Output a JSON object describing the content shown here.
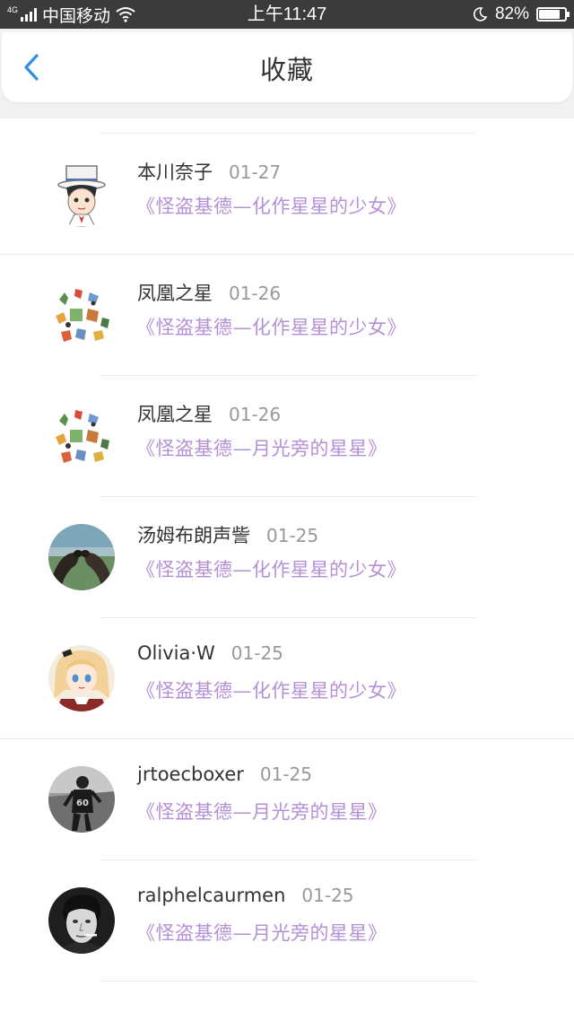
{
  "status_bar": {
    "network": "4G",
    "carrier": "中国移动",
    "time": "上午11:47",
    "battery": "82%",
    "battery_level": 0.82
  },
  "header": {
    "title": "收藏",
    "back_icon": "chevron-left-icon"
  },
  "colors": {
    "accent": "#2f8fe6",
    "book_title": "#b490d6",
    "status_bar_bg": "#3b3b3b"
  },
  "favorites": [
    {
      "name": "本川奈子",
      "date": "01-27",
      "title": "《怪盗基德—化作星星的少女》",
      "avatar": "anime-detective-avatar"
    },
    {
      "name": "凤凰之星",
      "date": "01-26",
      "title": "《怪盗基德—化作星星的少女》",
      "avatar": "cartoon-collage-avatar"
    },
    {
      "name": "凤凰之星",
      "date": "01-26",
      "title": "《怪盗基德—月光旁的星星》",
      "avatar": "cartoon-collage-avatar"
    },
    {
      "name": "汤姆布朗声訾",
      "date": "01-25",
      "title": "《怪盗基德—化作星星的少女》",
      "avatar": "sea-lions-avatar"
    },
    {
      "name": "Olivia·W",
      "date": "01-25",
      "title": "《怪盗基德—化作星星的少女》",
      "avatar": "anime-girl-avatar"
    },
    {
      "name": "jrtoecboxer",
      "date": "01-25",
      "title": "《怪盗基德—月光旁的星星》",
      "avatar": "basketball-player-avatar"
    },
    {
      "name": "ralphelcaurmen",
      "date": "01-25",
      "title": "《怪盗基德—月光旁的星星》",
      "avatar": "man-portrait-avatar"
    }
  ]
}
